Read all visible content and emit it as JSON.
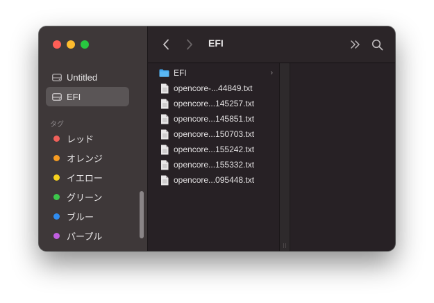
{
  "window": {
    "title": "EFI"
  },
  "sidebar": {
    "locations": [
      {
        "label": "Untitled",
        "selected": false
      },
      {
        "label": "EFI",
        "selected": true
      }
    ],
    "tags_section_label": "タグ",
    "tags": [
      {
        "label": "レッド",
        "color": "#f0605a"
      },
      {
        "label": "オレンジ",
        "color": "#f59b22"
      },
      {
        "label": "イエロー",
        "color": "#f7d11e"
      },
      {
        "label": "グリーン",
        "color": "#3cc74b"
      },
      {
        "label": "ブルー",
        "color": "#2f8cf0"
      },
      {
        "label": "パープル",
        "color": "#c05fe0"
      }
    ]
  },
  "toolbar": {
    "back_icon": "chevron-left-icon",
    "forward_icon": "chevron-right-icon",
    "more_icon": "double-chevron-right-icon",
    "search_icon": "magnifier-icon"
  },
  "column": {
    "items": [
      {
        "name": "EFI",
        "type": "folder",
        "has_children": true
      },
      {
        "name": "opencore-...44849.txt",
        "type": "file"
      },
      {
        "name": "opencore...145257.txt",
        "type": "file"
      },
      {
        "name": "opencore...145851.txt",
        "type": "file"
      },
      {
        "name": "opencore...150703.txt",
        "type": "file"
      },
      {
        "name": "opencore...155242.txt",
        "type": "file"
      },
      {
        "name": "opencore...155332.txt",
        "type": "file"
      },
      {
        "name": "opencore...095448.txt",
        "type": "file"
      }
    ],
    "chevron": "›"
  },
  "colors": {
    "sidebar_bg": "#3e3839",
    "content_bg": "#272125",
    "selection": "#5a5556",
    "folder": "#3fa7f0"
  }
}
